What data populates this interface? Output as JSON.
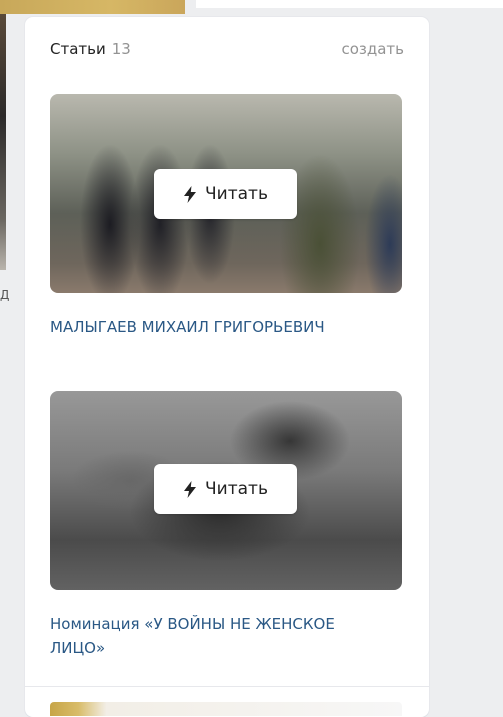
{
  "left_column": {
    "cut_text": "Д"
  },
  "articles_block": {
    "title": "Статьи",
    "count": "13",
    "create_label": "создать",
    "items": [
      {
        "title": "МАЛЫГАЕВ МИХАИЛ ГРИГОРЬЕВИЧ",
        "read_label": "Читать",
        "image_desc": "veterans-photo"
      },
      {
        "title": "Номинация «У ВОЙНЫ НЕ ЖЕНСКОЕ ЛИЦО»",
        "read_label": "Читать",
        "image_desc": "woman-soldier-drawing"
      }
    ]
  },
  "colors": {
    "link": "#2a5885",
    "muted": "#939393",
    "background": "#edeef0",
    "card": "#ffffff"
  },
  "icons": {
    "read": "lightning-bolt-icon"
  }
}
